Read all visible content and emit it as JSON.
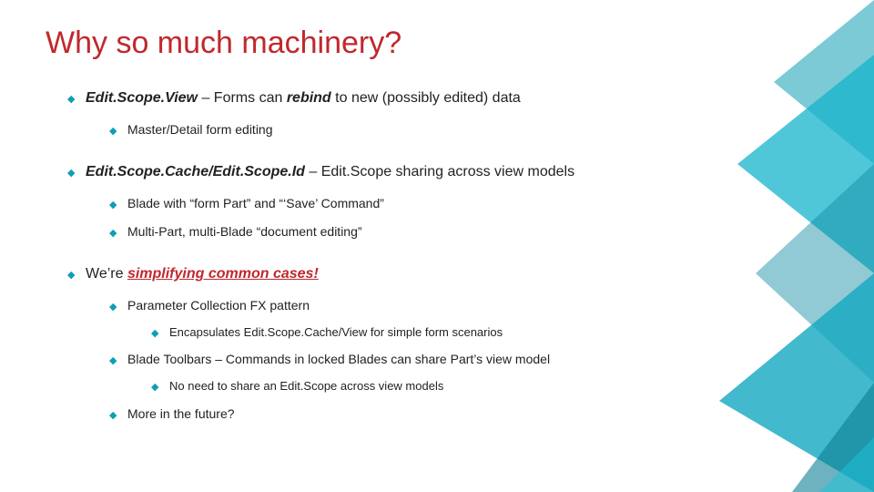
{
  "title": "Why so much machinery?",
  "bullets": {
    "b1": {
      "strong1": "Edit.Scope.View",
      "mid": " – Forms can ",
      "ital": "rebind",
      "tail": " to new (possibly edited) data",
      "c1": "Master/Detail form editing"
    },
    "b2": {
      "strong1": "Edit.Scope.Cache/Edit.Scope.Id",
      "tail": " – Edit.Scope sharing across view models",
      "c1": "Blade with “form Part” and “‘Save’ Command”",
      "c2": "Multi-Part, multi-Blade “document editing”"
    },
    "b3": {
      "pre": "We’re ",
      "emph": "simplifying common cases!",
      "c1": "Parameter Collection FX pattern",
      "c1a": "Encapsulates Edit.Scope.Cache/View for simple form scenarios",
      "c2": "Blade Toolbars – Commands in locked Blades can share Part’s view model",
      "c2a": "No need to share an Edit.Scope across view models",
      "c3": "More in the future?"
    }
  }
}
